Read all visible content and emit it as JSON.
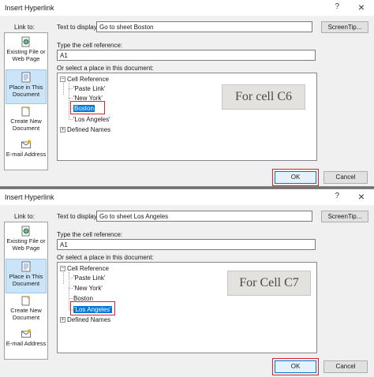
{
  "dialogs": [
    {
      "title": "Insert Hyperlink",
      "help": "?",
      "close": "×",
      "link_to_label": "Link to:",
      "sidebar": [
        {
          "label": "Existing File or Web Page",
          "icon": "globe-file-icon",
          "active": false
        },
        {
          "label": "Place in This Document",
          "icon": "document-icon",
          "active": true
        },
        {
          "label": "Create New Document",
          "icon": "new-document-icon",
          "active": false
        },
        {
          "label": "E-mail Address",
          "icon": "email-icon",
          "active": false
        }
      ],
      "text_to_display_label": "Text to display:",
      "text_to_display_value": "Go to sheet Boston",
      "screentip_label": "ScreenTip...",
      "cell_ref_label": "Type the cell reference:",
      "cell_ref_value": "A1",
      "select_place_label": "Or select a place in this document:",
      "tree": {
        "root": "Cell Reference",
        "items": [
          "'Paste Link'",
          "'New York'",
          "Boston",
          "'Los Angeles'"
        ],
        "selected_index": 2,
        "defined_names": "Defined Names"
      },
      "callout": "For cell C6",
      "ok_label": "OK",
      "cancel_label": "Cancel"
    },
    {
      "title": "Insert Hyperlink",
      "help": "?",
      "close": "×",
      "link_to_label": "Link to:",
      "sidebar": [
        {
          "label": "Existing File or Web Page",
          "icon": "globe-file-icon",
          "active": false
        },
        {
          "label": "Place in This Document",
          "icon": "document-icon",
          "active": true
        },
        {
          "label": "Create New Document",
          "icon": "new-document-icon",
          "active": false
        },
        {
          "label": "E-mail Address",
          "icon": "email-icon",
          "active": false
        }
      ],
      "text_to_display_label": "Text to display:",
      "text_to_display_value": "Go to sheet Los Angeles",
      "screentip_label": "ScreenTip...",
      "cell_ref_label": "Type the cell reference:",
      "cell_ref_value": "A1",
      "select_place_label": "Or select a place in this document:",
      "tree": {
        "root": "Cell Reference",
        "items": [
          "'Paste Link'",
          "'New York'",
          "Boston",
          "'Los Angeles'"
        ],
        "selected_index": 3,
        "defined_names": "Defined Names"
      },
      "callout": "For Cell C7",
      "ok_label": "OK",
      "cancel_label": "Cancel"
    }
  ],
  "colors": {
    "selection": "#0078d7",
    "highlight_box": "#d9262c",
    "active_sidebar": "#cce4f7",
    "callout_bg": "#e4e2de"
  }
}
